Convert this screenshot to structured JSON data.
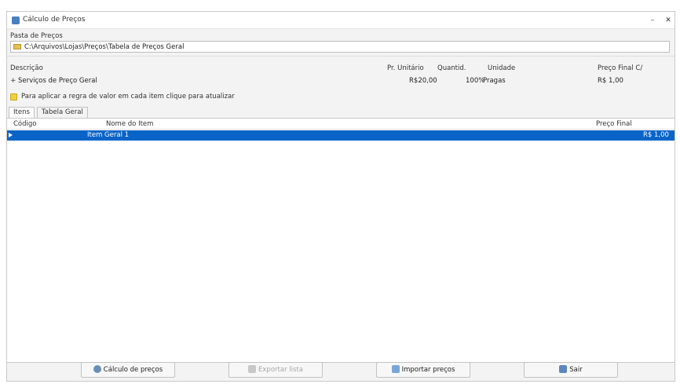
{
  "window": {
    "title": "Cálculo de Preços",
    "minimize_glyph": "–",
    "close_glyph": "✕"
  },
  "folder": {
    "label": "Pasta de Preços",
    "path": "C:\\Arquivos\\Lojas\\Preços\\Tabela de Preços Geral"
  },
  "pricing": {
    "headers": {
      "description": "Descrição",
      "unit_price": "Pr. Unitário",
      "quantity": "Quantid.",
      "unit": "Unidade",
      "final_price": "Preço Final C/"
    },
    "row": {
      "expander": "+",
      "description": "Serviços de Preço Geral",
      "unit_price": "R$20,00",
      "quantity": "100%",
      "unit": "Pragas",
      "final_price": "R$ 1,00"
    }
  },
  "status": {
    "message": "Para aplicar a regra de valor em cada item clique para atualizar"
  },
  "tabs": [
    {
      "label": "Itens",
      "active": true
    },
    {
      "label": "Tabela Geral",
      "active": false
    }
  ],
  "list": {
    "headers": {
      "code": "Código",
      "name": "Nome do Item",
      "final_value": "Preço Final"
    },
    "selected_row": {
      "name": "Item Geral 1",
      "value": "R$ 1,00"
    }
  },
  "buttons": {
    "calculate": "Cálculo de preços",
    "export": "Exportar lista",
    "import": "Importar preços",
    "exit": "Sair"
  },
  "colors": {
    "selection": "#0a64c8",
    "window_bg": "#f3f3f3"
  },
  "icons": [
    "app-icon",
    "folder-icon",
    "warning-icon",
    "gear-icon",
    "export-icon",
    "import-icon",
    "exit-icon"
  ]
}
